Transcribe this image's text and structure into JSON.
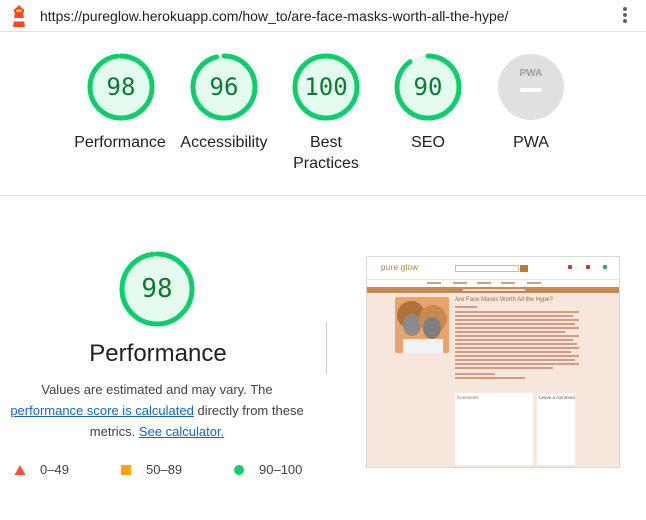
{
  "url_bar": {
    "url": "https://pureglow.herokuapp.com/how_to/are-face-masks-worth-all-the-hype/",
    "logo_icon": "lighthouse-icon",
    "menu_icon": "kebab-menu-icon"
  },
  "colors": {
    "pass_green": "#0cce6b",
    "pass_text": "#0c7a37",
    "average_orange": "#ffa400",
    "fail_red": "#ff4e42",
    "link_blue": "#1565c0",
    "na_gray": "#9e9e9e"
  },
  "categories": [
    {
      "label": "Performance",
      "score": "98",
      "value": 98
    },
    {
      "label": "Accessibility",
      "score": "96",
      "value": 96
    },
    {
      "label": "Best Practices",
      "label_line1": "Best",
      "label_line2": "Practices",
      "score": "100",
      "value": 100
    },
    {
      "label": "SEO",
      "score": "90",
      "value": 90
    },
    {
      "label": "PWA",
      "badge": "PWA"
    }
  ],
  "performance": {
    "score": "98",
    "value": 98,
    "title": "Performance",
    "desc_part1": "Values are estimated and may vary. The",
    "link_score": "performance score is calculated",
    "desc_part2": "directly from these metrics.",
    "link_calculator": "See calculator."
  },
  "legend": [
    {
      "range": "0–49",
      "icon": "triangle-icon"
    },
    {
      "range": "50–89",
      "icon": "square-icon"
    },
    {
      "range": "90–100",
      "icon": "circle-icon"
    }
  ],
  "screenshot": {
    "brand": "pure glow",
    "article_title": "Are Face Masks Worth All the Hype?",
    "comments_heading": "Comments",
    "leave_comment": "Leave a comment"
  }
}
